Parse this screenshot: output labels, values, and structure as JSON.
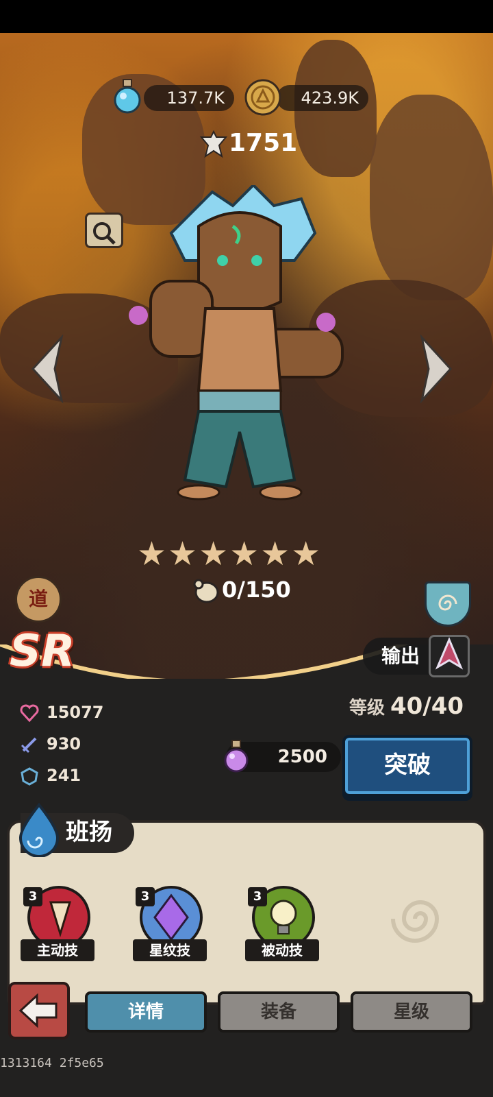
{
  "resources": {
    "potion": {
      "value": "137.7K",
      "icon": "blue-potion-icon"
    },
    "coin": {
      "value": "423.9K",
      "icon": "gold-coin-icon"
    }
  },
  "hero": {
    "power": "1751",
    "stars": 6,
    "shards": "0/150",
    "rarity": "SR",
    "faction_badge": "道",
    "role": "输出",
    "name": "班扬"
  },
  "stats": {
    "hp": "15077",
    "attack": "930",
    "defense": "241"
  },
  "progression": {
    "level_label": "等级",
    "level_value": "40/40",
    "cost": "2500",
    "breakthrough_label": "突破"
  },
  "skills": [
    {
      "level": "3",
      "label": "主动技",
      "color": "#c0283a"
    },
    {
      "level": "3",
      "label": "星纹技",
      "color": "#5a8fd6"
    },
    {
      "level": "3",
      "label": "被动技",
      "color": "#6a9a2a"
    }
  ],
  "tabs": [
    {
      "label": "详情",
      "active": true
    },
    {
      "label": "装备",
      "active": false
    },
    {
      "label": "星级",
      "active": false
    }
  ],
  "watermark": "1313164 2f5e65"
}
